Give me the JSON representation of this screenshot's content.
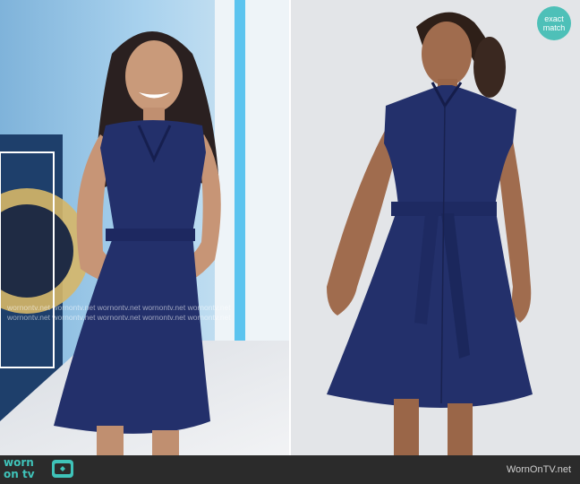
{
  "badge": {
    "line1": "exact",
    "line2": "match"
  },
  "watermark": {
    "row1": "wornontv.net wornontv.net wornontv.net wornontv.net wornontv.net",
    "row2": "wornontv.net wornontv.net wornontv.net wornontv.net wornontv.net"
  },
  "footer": {
    "logo_line1": "worn",
    "logo_line2": "on tv",
    "site": "WornOnTV.net"
  },
  "colors": {
    "dress": "#23306b",
    "accent": "#3fc3b9",
    "footer_bg": "#2b2b2b"
  }
}
